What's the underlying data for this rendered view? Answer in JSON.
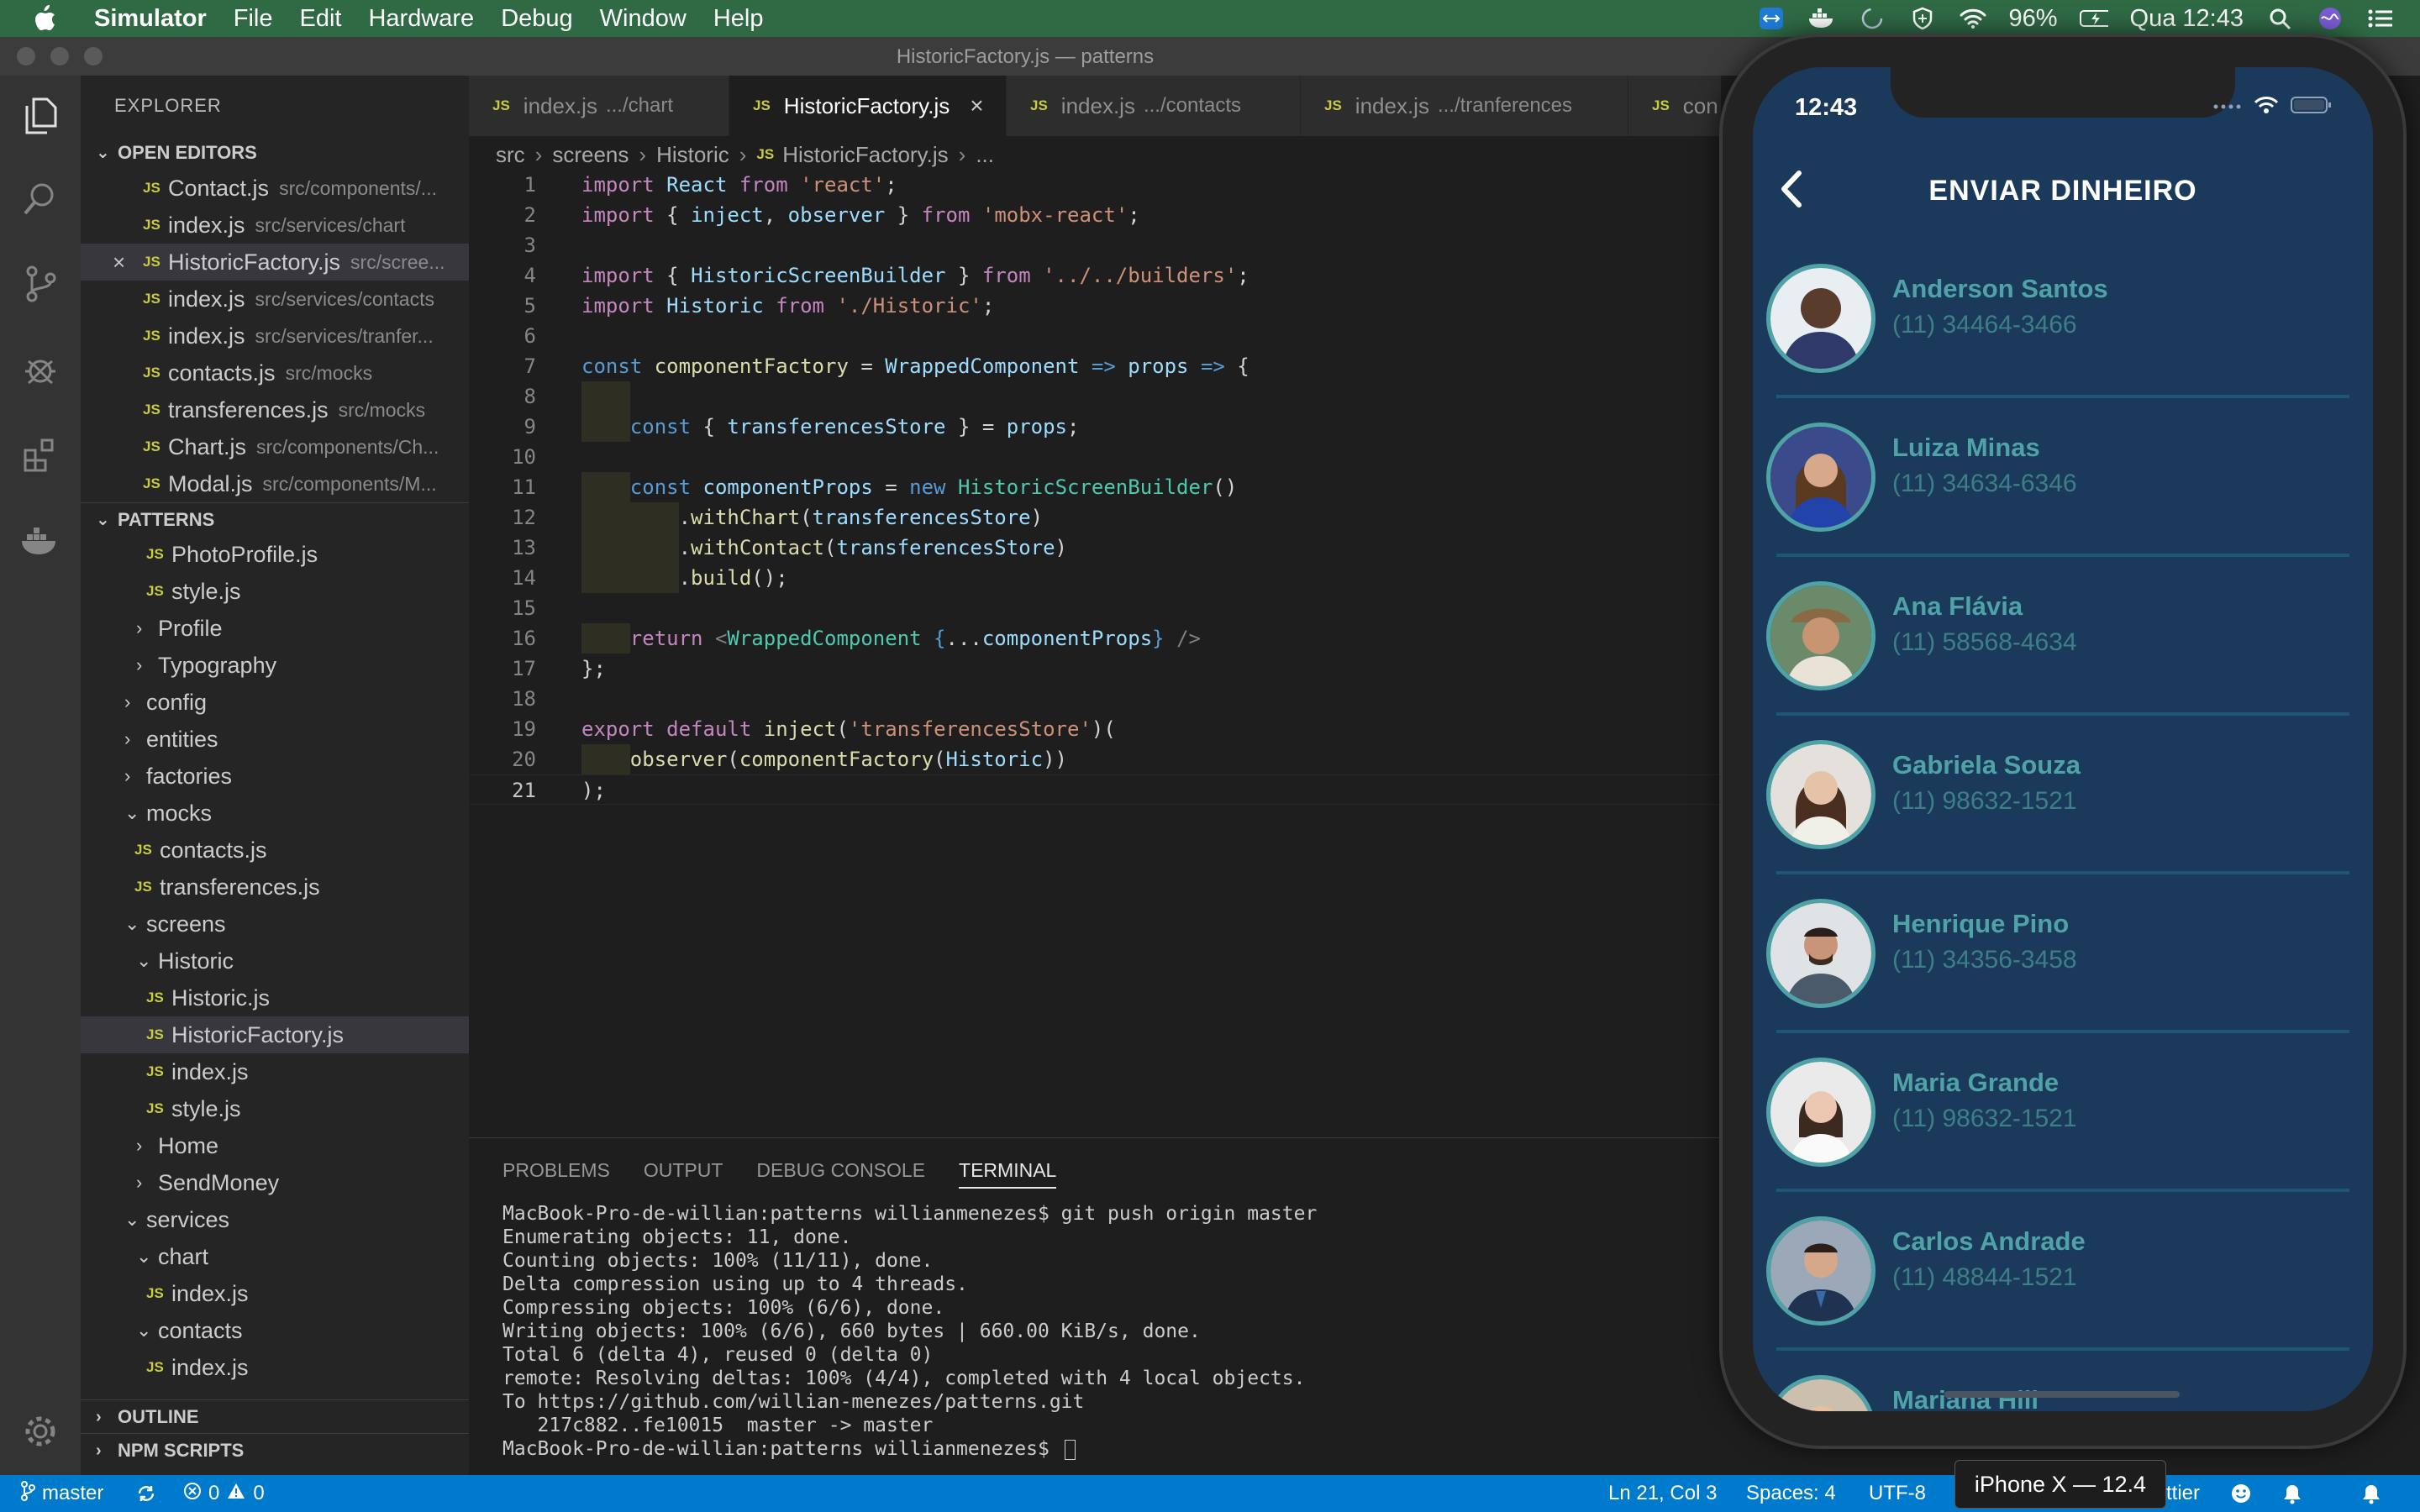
{
  "menubar": {
    "app_name": "Simulator",
    "items": [
      "File",
      "Edit",
      "Hardware",
      "Debug",
      "Window",
      "Help"
    ],
    "battery": "96%",
    "clock": "Qua 12:43"
  },
  "window": {
    "title": "HistoricFactory.js — patterns"
  },
  "sidebar": {
    "title": "EXPLORER",
    "open_editors_label": "OPEN EDITORS",
    "open_editors": [
      {
        "name": "Contact.js",
        "desc": "src/components/..."
      },
      {
        "name": "index.js",
        "desc": "src/services/chart"
      },
      {
        "name": "HistoricFactory.js",
        "desc": "src/scree..."
      },
      {
        "name": "index.js",
        "desc": "src/services/contacts"
      },
      {
        "name": "index.js",
        "desc": "src/services/tranfer..."
      },
      {
        "name": "contacts.js",
        "desc": "src/mocks"
      },
      {
        "name": "transferences.js",
        "desc": "src/mocks"
      },
      {
        "name": "Chart.js",
        "desc": "src/components/Ch..."
      },
      {
        "name": "Modal.js",
        "desc": "src/components/M..."
      }
    ],
    "project_label": "PATTERNS",
    "tree": [
      {
        "label": "PhotoProfile.js"
      },
      {
        "label": "style.js"
      },
      {
        "label": "Profile"
      },
      {
        "label": "Typography"
      },
      {
        "label": "config"
      },
      {
        "label": "entities"
      },
      {
        "label": "factories"
      },
      {
        "label": "mocks"
      },
      {
        "label": "contacts.js"
      },
      {
        "label": "transferences.js"
      },
      {
        "label": "screens"
      },
      {
        "label": "Historic"
      },
      {
        "label": "Historic.js"
      },
      {
        "label": "HistoricFactory.js"
      },
      {
        "label": "index.js"
      },
      {
        "label": "style.js"
      },
      {
        "label": "Home"
      },
      {
        "label": "SendMoney"
      },
      {
        "label": "services"
      },
      {
        "label": "chart"
      },
      {
        "label": "index.js"
      },
      {
        "label": "contacts"
      },
      {
        "label": "index.js"
      }
    ],
    "outline_label": "OUTLINE",
    "npm_label": "NPM SCRIPTS"
  },
  "tabs": [
    {
      "name": "index.js",
      "desc": ".../chart"
    },
    {
      "name": "HistoricFactory.js",
      "desc": ""
    },
    {
      "name": "index.js",
      "desc": ".../contacts"
    },
    {
      "name": "index.js",
      "desc": ".../tranferences"
    },
    {
      "name": "con",
      "desc": ""
    }
  ],
  "breadcrumb": [
    "src",
    "screens",
    "Historic",
    "HistoricFactory.js",
    "..."
  ],
  "code_line_numbers": [
    "1",
    "2",
    "3",
    "4",
    "5",
    "6",
    "7",
    "8",
    "9",
    "10",
    "11",
    "12",
    "13",
    "14",
    "15",
    "16",
    "17",
    "18",
    "19",
    "20",
    "21"
  ],
  "panel": {
    "tabs": [
      "PROBLEMS",
      "OUTPUT",
      "DEBUG CONSOLE",
      "TERMINAL"
    ],
    "terminal_lines": [
      "MacBook-Pro-de-willian:patterns willianmenezes$ git push origin master",
      "Enumerating objects: 11, done.",
      "Counting objects: 100% (11/11), done.",
      "Delta compression using up to 4 threads.",
      "Compressing objects: 100% (6/6), done.",
      "Writing objects: 100% (6/6), 660 bytes | 660.00 KiB/s, done.",
      "Total 6 (delta 4), reused 0 (delta 0)",
      "remote: Resolving deltas: 100% (4/4), completed with 4 local objects.",
      "To https://github.com/willian-menezes/patterns.git",
      "   217c882..fe10015  master -> master",
      "MacBook-Pro-de-willian:patterns willianmenezes$ "
    ]
  },
  "statusbar": {
    "branch": "master",
    "errors": "0",
    "warnings": "0",
    "position": "Ln 21, Col 3",
    "spaces": "Spaces: 4",
    "encoding": "UTF-8",
    "formatter": "ttier"
  },
  "phone": {
    "time": "12:43",
    "title": "ENVIAR DINHEIRO",
    "contacts": [
      {
        "name": "Anderson Santos",
        "phone": "(11) 34464-3466"
      },
      {
        "name": "Luiza Minas",
        "phone": "(11) 34634-6346"
      },
      {
        "name": "Ana Flávia",
        "phone": "(11) 58568-4634"
      },
      {
        "name": "Gabriela Souza",
        "phone": "(11) 98632-1521"
      },
      {
        "name": "Henrique Pino",
        "phone": "(11) 34356-3458"
      },
      {
        "name": "Maria Grande",
        "phone": "(11) 98632-1521"
      },
      {
        "name": "Carlos Andrade",
        "phone": "(11) 48844-1521"
      },
      {
        "name": "Mariana Hill",
        "phone": ""
      }
    ],
    "device_label": "iPhone X — 12.4"
  },
  "colors": {
    "menubar": "#2f6a45",
    "statusbar": "#007acc",
    "phone_bg": "#1b3a5b",
    "contact_accent": "#4fa3a6"
  }
}
